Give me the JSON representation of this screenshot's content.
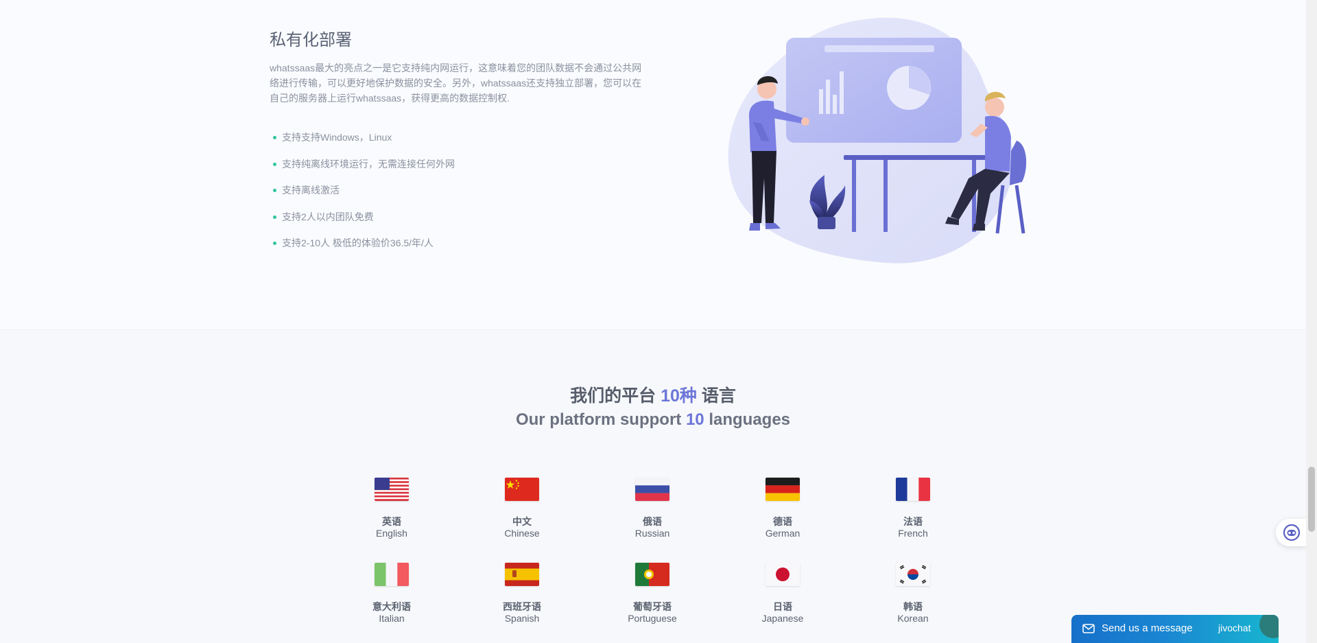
{
  "private": {
    "title": "私有化部署",
    "description": "whatssaas最大的亮点之一是它支持纯内网运行，这意味着您的团队数据不会通过公共网络进行传输，可以更好地保护数据的安全。另外，whatssaas还支持独立部署，您可以在自己的服务器上运行whatssaas，获得更高的数据控制权.",
    "features": [
      "支持支持Windows，Linux",
      "支持纯离线环境运行，无需连接任何外网",
      "支持离线激活",
      "支持2人以内团队免费",
      "支持2-10人 极低的体验价36.5/年/人"
    ]
  },
  "languages_section": {
    "heading_zh_prefix": "我们的平台 ",
    "heading_zh_accent": "10种",
    "heading_zh_suffix": " 语言",
    "heading_en_prefix": "Our platform support ",
    "heading_en_accent": "10",
    "heading_en_suffix": " languages",
    "languages": [
      {
        "zh": "英语",
        "en": "English",
        "flag": "us-flag-icon"
      },
      {
        "zh": "中文",
        "en": "Chinese",
        "flag": "china-flag-icon"
      },
      {
        "zh": "俄语",
        "en": "Russian",
        "flag": "russia-flag-icon"
      },
      {
        "zh": "德语",
        "en": "German",
        "flag": "germany-flag-icon"
      },
      {
        "zh": "法语",
        "en": "French",
        "flag": "france-flag-icon"
      },
      {
        "zh": "意大利语",
        "en": "Italian",
        "flag": "italy-flag-icon"
      },
      {
        "zh": "西班牙语",
        "en": "Spanish",
        "flag": "spain-flag-icon"
      },
      {
        "zh": "葡萄牙语",
        "en": "Portuguese",
        "flag": "portugal-flag-icon"
      },
      {
        "zh": "日语",
        "en": "Japanese",
        "flag": "japan-flag-icon"
      },
      {
        "zh": "韩语",
        "en": "Korean",
        "flag": "korea-flag-icon"
      }
    ]
  },
  "chat_widget": {
    "message": "Send us a message",
    "brand": "jivochat"
  },
  "colors": {
    "accent": "#6c76d8",
    "bullet": "#2ec4a0",
    "chat_gradient_start": "#1670c9",
    "chat_gradient_end": "#18b7cf"
  }
}
